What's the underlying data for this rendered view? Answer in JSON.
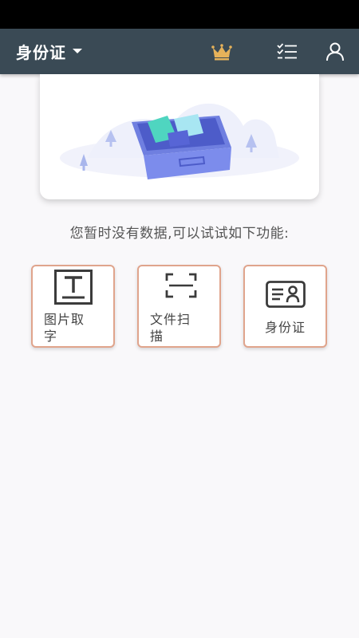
{
  "app_bar": {
    "title": "身份证",
    "icons": [
      "caret-down-icon",
      "crown-icon",
      "checklist-icon",
      "user-icon"
    ],
    "background": "#3a4a55",
    "crown_color": "#e6b25a"
  },
  "empty_state": {
    "message": "您暂时没有数据,可以试试如下功能:",
    "illustration": "empty-box-illustration"
  },
  "functions": [
    {
      "label": "图片取字",
      "icon": "text-recognition-icon"
    },
    {
      "label": "文件扫描",
      "icon": "scan-frame-icon"
    },
    {
      "label": "身份证",
      "icon": "id-card-icon"
    }
  ],
  "tile_border_color": "#e0a48c"
}
